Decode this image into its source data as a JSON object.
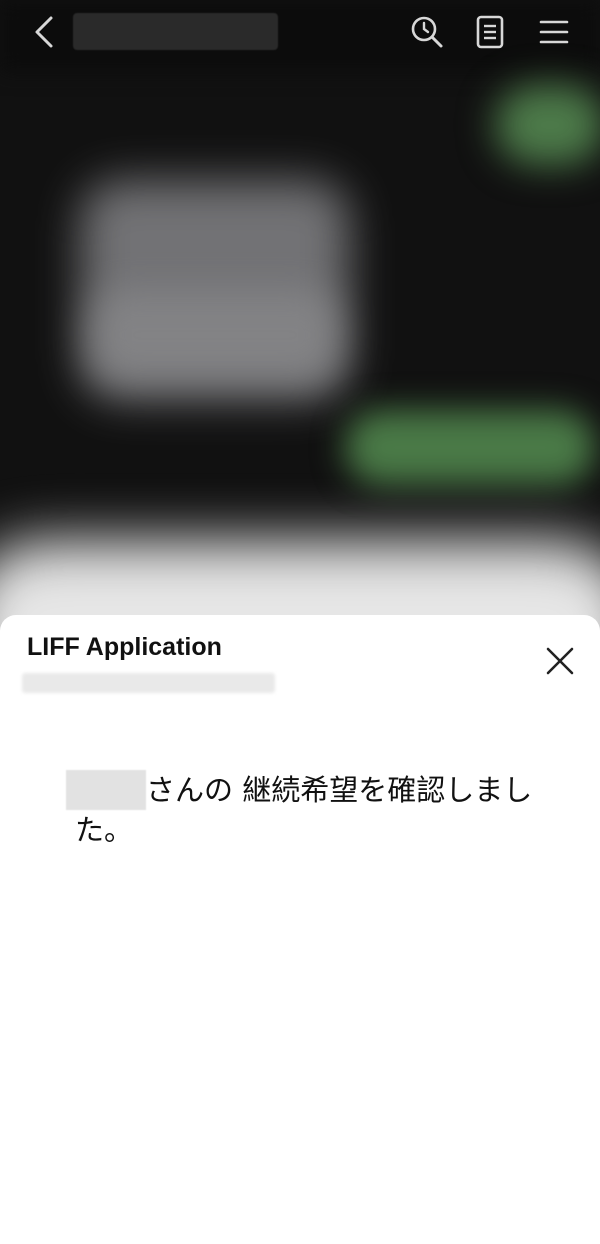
{
  "header": {
    "back_icon": "chevron-left-icon",
    "search_icon": "search-history-icon",
    "note_icon": "note-icon",
    "menu_icon": "hamburger-menu-icon"
  },
  "liff": {
    "title": "LIFF Application",
    "close_icon": "close-icon",
    "message_suffix": "さんの 継続希望を確認しました。"
  },
  "colors": {
    "chat_background": "#111111",
    "bubble_green": "#4a7a47",
    "sheet_background": "#ffffff"
  }
}
